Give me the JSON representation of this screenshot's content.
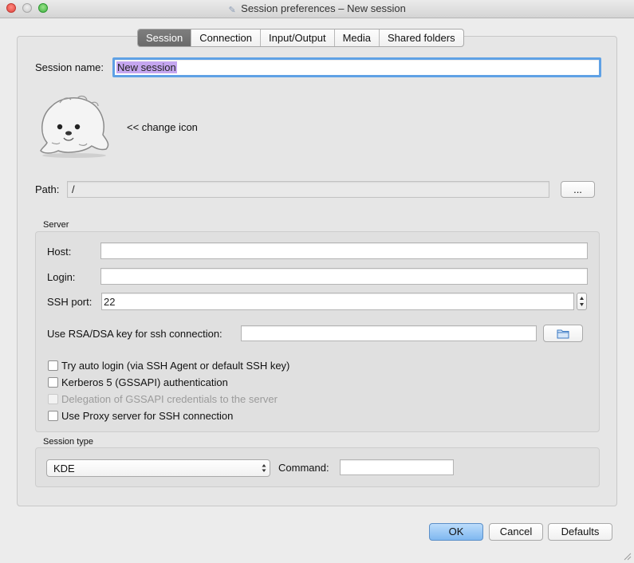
{
  "window": {
    "title": "Session preferences – New session"
  },
  "tabs": [
    "Session",
    "Connection",
    "Input/Output",
    "Media",
    "Shared folders"
  ],
  "session": {
    "name_label": "Session name:",
    "name_value": "New session",
    "change_icon_label": "<< change icon",
    "path_label": "Path:",
    "path_value": "/",
    "browse_label": "..."
  },
  "server": {
    "title": "Server",
    "host_label": "Host:",
    "host_value": "",
    "login_label": "Login:",
    "login_value": "",
    "ssh_port_label": "SSH port:",
    "ssh_port_value": "22",
    "rsa_label": "Use RSA/DSA key for ssh connection:",
    "rsa_value": "",
    "checkboxes": [
      {
        "label": "Try auto login (via SSH Agent or default SSH key)",
        "checked": false,
        "enabled": true
      },
      {
        "label": "Kerberos 5 (GSSAPI) authentication",
        "checked": false,
        "enabled": true
      },
      {
        "label": "Delegation of GSSAPI credentials to the server",
        "checked": false,
        "enabled": false
      },
      {
        "label": "Use Proxy server for SSH connection",
        "checked": false,
        "enabled": true
      }
    ]
  },
  "session_type": {
    "title": "Session type",
    "selected": "KDE",
    "command_label": "Command:",
    "command_value": ""
  },
  "buttons": {
    "ok": "OK",
    "cancel": "Cancel",
    "defaults": "Defaults"
  },
  "colors": {
    "focus_ring": "#5fa1e5",
    "default_button": "#7fb8f0",
    "active_tab": "#737373"
  }
}
